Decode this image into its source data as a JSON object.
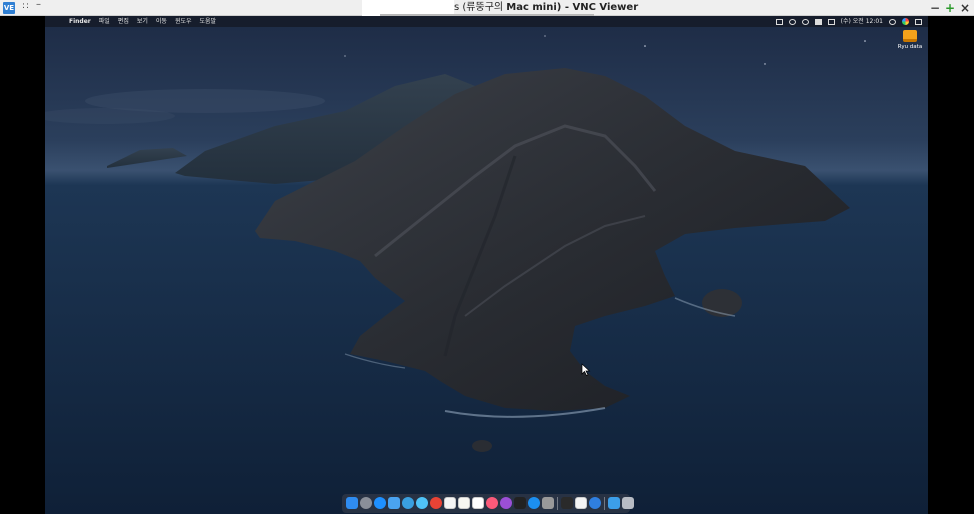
{
  "vnc": {
    "app_icon_text": "VE",
    "grip": "::",
    "dash": "–",
    "title_prefix": "s (류뚱구의 ",
    "title_bold": "Mac mini) - VNC Viewer",
    "minimize": "−",
    "maximize": "+",
    "close": "×"
  },
  "mac": {
    "apple": "",
    "menus": [
      "Finder",
      "파일",
      "편집",
      "보기",
      "이동",
      "윈도우",
      "도움말"
    ],
    "clock": "(수) 오전 12:01",
    "status_icons": [
      "airplay-icon",
      "bluetooth-icon",
      "wifi-icon",
      "input-source-icon",
      "volume-icon",
      "clock-text",
      "spotlight-icon",
      "siri-icon",
      "control-list-icon"
    ]
  },
  "desktop": {
    "items": [
      {
        "label": "Ryu data",
        "icon": "external-drive-icon"
      }
    ]
  },
  "dock": {
    "apps": [
      {
        "name": "finder-icon",
        "color": "#2f8cf0"
      },
      {
        "name": "launchpad-icon",
        "color": "#8a8f99"
      },
      {
        "name": "safari-icon",
        "color": "#1e90ff"
      },
      {
        "name": "mail-icon",
        "color": "#4aa3f0"
      },
      {
        "name": "facetime-icon",
        "color": "#3aa0e0"
      },
      {
        "name": "messages-icon",
        "color": "#4fc3f7"
      },
      {
        "name": "chrome-icon",
        "color": "#e84335"
      },
      {
        "name": "calendar-icon",
        "color": "#f5f5f5"
      },
      {
        "name": "notes-icon",
        "color": "#f7f7f2"
      },
      {
        "name": "reminders-icon",
        "color": "#ffffff"
      },
      {
        "name": "music-icon",
        "color": "#fa5a7a"
      },
      {
        "name": "podcasts-icon",
        "color": "#9b4fd6"
      },
      {
        "name": "tv-icon",
        "color": "#222222"
      },
      {
        "name": "app-store-icon",
        "color": "#1c8ff0"
      },
      {
        "name": "system-preferences-icon",
        "color": "#9a9a9a"
      },
      {
        "name": "terminal-icon",
        "color": "#2a2a2a"
      },
      {
        "name": "textedit-icon",
        "color": "#f4f4f4"
      },
      {
        "name": "browser-icon",
        "color": "#2f7fe0"
      },
      {
        "name": "downloads-folder-icon",
        "color": "#3c9ee8"
      },
      {
        "name": "trash-icon",
        "color": "#b8bcc4"
      }
    ]
  }
}
